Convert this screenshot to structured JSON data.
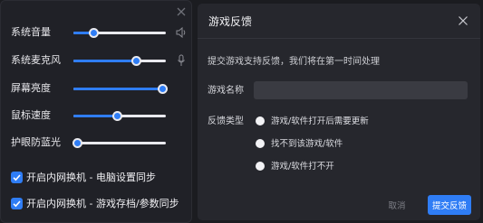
{
  "quick_settings": {
    "sliders": [
      {
        "label": "系统音量",
        "level": 0.22,
        "icon": "speaker-icon"
      },
      {
        "label": "系统麦克风",
        "level": 0.68,
        "icon": "microphone-icon"
      },
      {
        "label": "屏幕亮度",
        "level": 0.96
      },
      {
        "label": "鼠标速度",
        "level": 0.47
      },
      {
        "label": "护眼防蓝光",
        "level": 0.04
      }
    ],
    "checkboxes": [
      {
        "label": "开启内网换机 - 电脑设置同步",
        "checked": true
      },
      {
        "label": "开启内网换机 - 游戏存档/参数同步",
        "checked": true
      }
    ]
  },
  "dialog": {
    "title": "游戏反馈",
    "description": "提交游戏支持反馈，我们将在第一时间处理",
    "game_name_label": "游戏名称",
    "game_name_value": "",
    "game_name_placeholder": "",
    "feedback_type_label": "反馈类型",
    "options": [
      "游戏/软件打开后需要更新",
      "找不到该游戏/软件",
      "游戏/软件打不开"
    ],
    "cancel_label": "取消",
    "submit_label": "提交反馈"
  },
  "colors": {
    "accent": "#2f7df5",
    "panel_bg": "#202127",
    "dialog_bg": "#26272d"
  }
}
